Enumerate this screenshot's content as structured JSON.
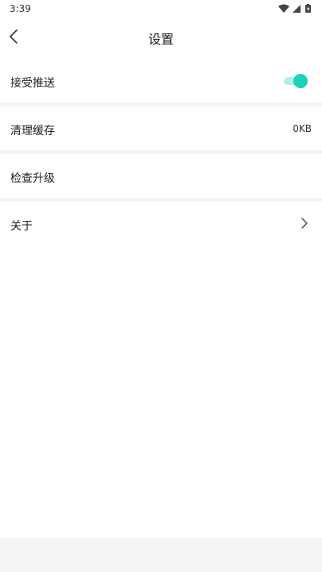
{
  "status_bar": {
    "time": "3:39",
    "icons": [
      "wifi-icon",
      "signal-icon",
      "battery-icon"
    ]
  },
  "app_bar": {
    "title": "设置",
    "back_icon": "chevron-left-icon"
  },
  "settings": {
    "push": {
      "label": "接受推送",
      "enabled": true,
      "accent": "#1ad3b9"
    },
    "cache": {
      "label": "清理缓存",
      "value": "0KB"
    },
    "update": {
      "label": "检查升级"
    },
    "about": {
      "label": "关于",
      "icon": "chevron-right-icon"
    }
  }
}
